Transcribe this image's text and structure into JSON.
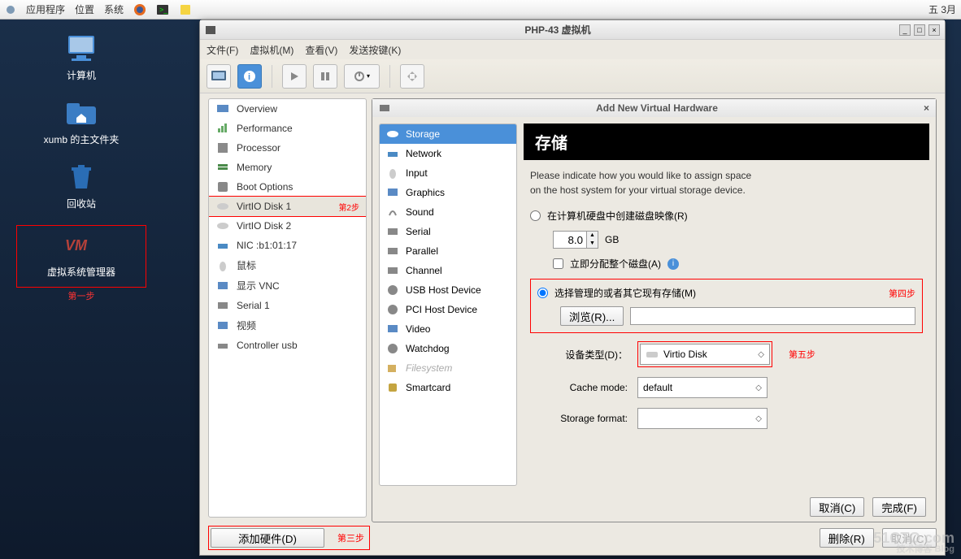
{
  "top_panel": {
    "apps": "应用程序",
    "places": "位置",
    "system": "系统",
    "date": "五 3月"
  },
  "desktop": {
    "computer": "计算机",
    "home": "xumb 的主文件夹",
    "trash": "回收站",
    "vmm": "虚拟系统管理器",
    "step1": "第一步"
  },
  "window": {
    "title": "PHP-43 虚拟机",
    "menu": {
      "file": "文件(F)",
      "vm": "虚拟机(M)",
      "view": "查看(V)",
      "send": "发送按键(K)"
    },
    "sidebar": [
      {
        "label": "Overview"
      },
      {
        "label": "Performance"
      },
      {
        "label": "Processor"
      },
      {
        "label": "Memory"
      },
      {
        "label": "Boot Options"
      },
      {
        "label": "VirtIO Disk 1",
        "selected": true,
        "step": "第2步"
      },
      {
        "label": "VirtIO Disk 2"
      },
      {
        "label": "NIC :b1:01:17"
      },
      {
        "label": "鼠标"
      },
      {
        "label": "显示 VNC"
      },
      {
        "label": "Serial 1"
      },
      {
        "label": "视频"
      },
      {
        "label": "Controller usb"
      }
    ],
    "add_hw_btn": "添加硬件(D)",
    "add_hw_step": "第三步",
    "remove_btn": "删除(R)",
    "cancel2_btn": "取消(C)"
  },
  "dialog": {
    "title": "Add New Virtual Hardware",
    "hw_list": [
      {
        "label": "Storage",
        "selected": true
      },
      {
        "label": "Network"
      },
      {
        "label": "Input"
      },
      {
        "label": "Graphics"
      },
      {
        "label": "Sound"
      },
      {
        "label": "Serial"
      },
      {
        "label": "Parallel"
      },
      {
        "label": "Channel"
      },
      {
        "label": "USB Host Device"
      },
      {
        "label": "PCI Host Device"
      },
      {
        "label": "Video"
      },
      {
        "label": "Watchdog"
      },
      {
        "label": "Filesystem",
        "disabled": true
      },
      {
        "label": "Smartcard"
      }
    ],
    "banner": "存储",
    "intro1": "Please indicate how you would like to assign space",
    "intro2": "on the host system for your virtual storage device.",
    "opt1": "在计算机硬盘中创建磁盘映像(R)",
    "size_val": "8.0",
    "size_unit": "GB",
    "alloc_now": "立即分配整个磁盘(A)",
    "opt2": "选择管理的或者其它现有存储(M)",
    "step4": "第四步",
    "browse": "浏览(R)...",
    "device_label": "设备类型(D)：",
    "device_val": "Virtio Disk",
    "step5": "第五步",
    "cache_label": "Cache mode:",
    "cache_val": "default",
    "format_label": "Storage format:",
    "cancel": "取消(C)",
    "finish": "完成(F)"
  },
  "watermark": {
    "main": "51CTO.com",
    "sub": "技术博客         Blog"
  }
}
